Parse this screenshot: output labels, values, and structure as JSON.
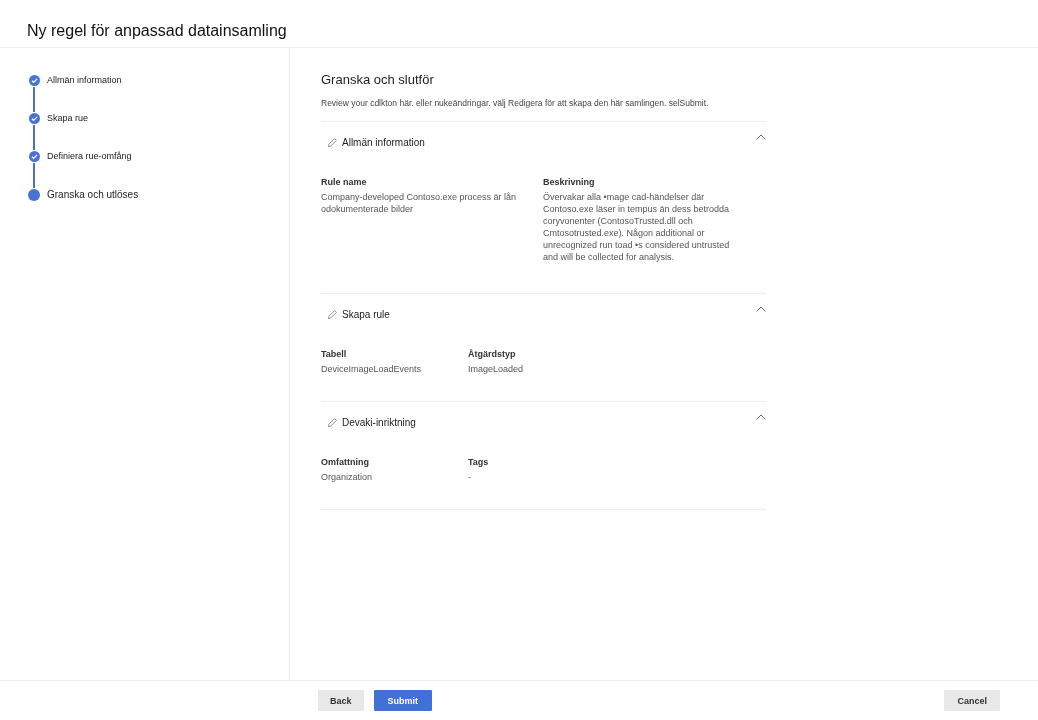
{
  "title": "Ny regel för anpassad datainsamling",
  "steps": [
    {
      "label": "Allmän information",
      "completed": true,
      "selected": false
    },
    {
      "label": "Skapa rue",
      "completed": true,
      "selected": false
    },
    {
      "label": "Definiera rue-omfång",
      "completed": true,
      "selected": false
    },
    {
      "label": "Granska och utlöses",
      "completed": false,
      "selected": true
    }
  ],
  "page": {
    "heading": "Granska och slutför",
    "description": "Review your cdlkton här. eller nukeändringar. välj Redigera för att skapa den här samlingen. selSubmit."
  },
  "sections": [
    {
      "title": "Allmän information",
      "expanded": true,
      "fields": [
        {
          "label": "Rule name",
          "value": "Company-developed Contoso.exe process är lån odokumenterade bilder"
        },
        {
          "label": "Beskrivning",
          "value": "Övervakar alla •mage cad-händelser där Contoso.exe läser in tempus än dess betrodda coryvonenter (ContosoTrusted.dll och Cmtosotrusted.exe). Någon additional or unrecognized run toad •s considered untrusted and will be collected for analysis."
        }
      ]
    },
    {
      "title": "Skapa rule",
      "expanded": true,
      "fields": [
        {
          "label": "Tabell",
          "value": "DeviceImageLoadEvents"
        },
        {
          "label": "Åtgärdstyp",
          "value": "ImageLoaded"
        }
      ]
    },
    {
      "title": "Devaki-inriktning",
      "expanded": true,
      "fields": [
        {
          "label": "Omfattning",
          "value": "Organization"
        },
        {
          "label": "Tags",
          "value": "-"
        }
      ]
    }
  ],
  "footer": {
    "buttons": [
      {
        "label": "Back",
        "kind": "secondary"
      },
      {
        "label": "Submit",
        "kind": "primary"
      }
    ],
    "cancel": "Cancel"
  }
}
